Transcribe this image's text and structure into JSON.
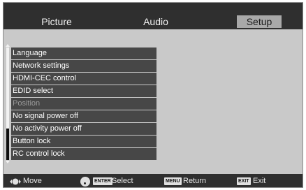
{
  "tabs": [
    {
      "label": "Picture",
      "active": false
    },
    {
      "label": "Audio",
      "active": false
    },
    {
      "label": "Setup",
      "active": true
    }
  ],
  "menu": {
    "items": [
      {
        "label": "Language",
        "enabled": true
      },
      {
        "label": "Network settings",
        "enabled": true
      },
      {
        "label": "HDMI-CEC control",
        "enabled": true
      },
      {
        "label": "EDID select",
        "enabled": true
      },
      {
        "label": "Position",
        "enabled": false
      },
      {
        "label": "No signal power off",
        "enabled": true
      },
      {
        "label": "No activity power off",
        "enabled": true
      },
      {
        "label": "Button lock",
        "enabled": true
      },
      {
        "label": "RC control lock",
        "enabled": true
      }
    ]
  },
  "footer": {
    "move_label": "Move",
    "enter_key": "ENTER",
    "select_label": "Select",
    "menu_key": "MENU",
    "return_label": "Return",
    "exit_key": "EXIT",
    "exit_label": "Exit"
  },
  "colors": {
    "menu_item_bg": "#474747",
    "active_tab_bg": "#a9a9a9",
    "bar_bg": "#2f2f2f"
  }
}
